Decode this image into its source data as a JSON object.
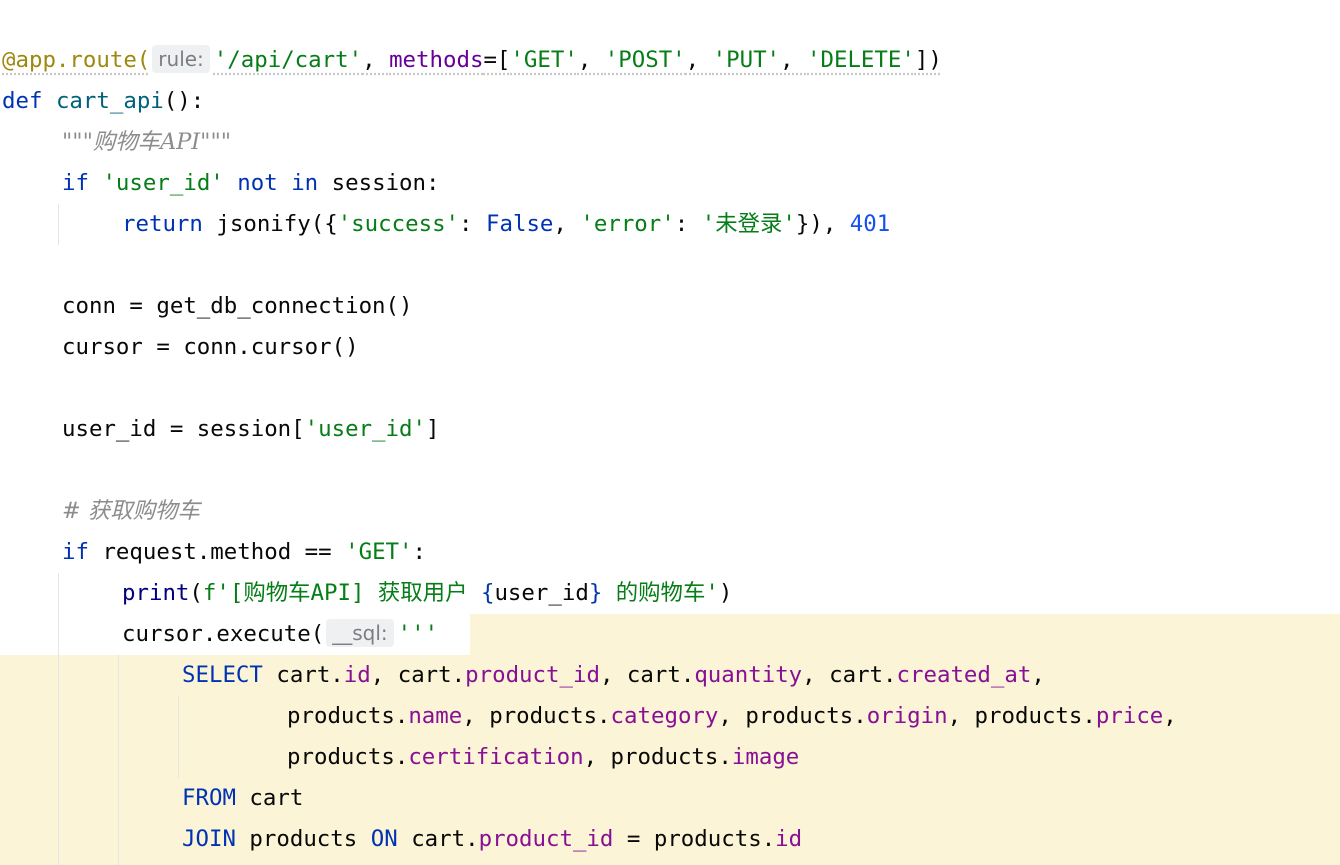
{
  "editor": {
    "language": "python",
    "hint_rule": "rule:",
    "hint_sql": "__sql:",
    "tokens": {
      "l1_decorator": "@app.route(",
      "l1_path": "'/api/cart'",
      "l1_comma1": ", ",
      "l1_methods": "methods",
      "l1_eq": "=[",
      "l1_get": "'GET'",
      "l1_c2": ", ",
      "l1_post": "'POST'",
      "l1_c3": ", ",
      "l1_put": "'PUT'",
      "l1_c4": ", ",
      "l1_delete": "'DELETE'",
      "l1_end": "])",
      "l2_def": "def",
      "l2_name": "cart_api",
      "l2_rest": "():",
      "l3_doc": "\"\"\"购物车API\"\"\"",
      "l4_if": "if",
      "l4_str": "'user_id'",
      "l4_not": "not",
      "l4_in": "in",
      "l4_rest": "session:",
      "l5_return": "return",
      "l5_call": "jsonify({",
      "l5_success": "'success'",
      "l5_colon1": ": ",
      "l5_false": "False",
      "l5_comma": ", ",
      "l5_error": "'error'",
      "l5_colon2": ": ",
      "l5_msg": "'未登录'",
      "l5_close": "}), ",
      "l5_code": "401",
      "l7": "conn = get_db_connection()",
      "l8": "cursor = conn.cursor()",
      "l10_pre": "user_id = session[",
      "l10_str": "'user_id'",
      "l10_post": "]",
      "l12_comment": "# 获取购物车",
      "l13_if": "if",
      "l13_mid": "request.method == ",
      "l13_str": "'GET'",
      "l13_end": ":",
      "l14_print": "print",
      "l14_open": "(",
      "l14_f1": "f'[购物车API] 获取用户 ",
      "l14_lb": "{",
      "l14_var": "user_id",
      "l14_rb": "}",
      "l14_f2": " 的购物车'",
      "l14_close": ")",
      "l15_call": "cursor.execute(",
      "l15_quote": "'''",
      "l16_select": "SELECT",
      "l16_t1": "cart.",
      "l16_c1": "id",
      "l16_s1": ", cart.",
      "l16_c2": "product_id",
      "l16_s2": ", cart.",
      "l16_c3": "quantity",
      "l16_s3": ", cart.",
      "l16_c4": "created_at",
      "l16_s4": ",",
      "l17_t1": "products.",
      "l17_c1": "name",
      "l17_s1": ", products.",
      "l17_c2": "category",
      "l17_s2": ", products.",
      "l17_c3": "origin",
      "l17_s3": ", products.",
      "l17_c4": "price",
      "l17_s4": ",",
      "l18_t1": "products.",
      "l18_c1": "certification",
      "l18_s1": ", products.",
      "l18_c2": "image",
      "l19_from": "FROM",
      "l19_t": "cart",
      "l20_join": "JOIN",
      "l20_t1": "products",
      "l20_on": "ON",
      "l20_t2": "cart.",
      "l20_c1": "product_id",
      "l20_eq": " = products.",
      "l20_c2": "id"
    }
  }
}
